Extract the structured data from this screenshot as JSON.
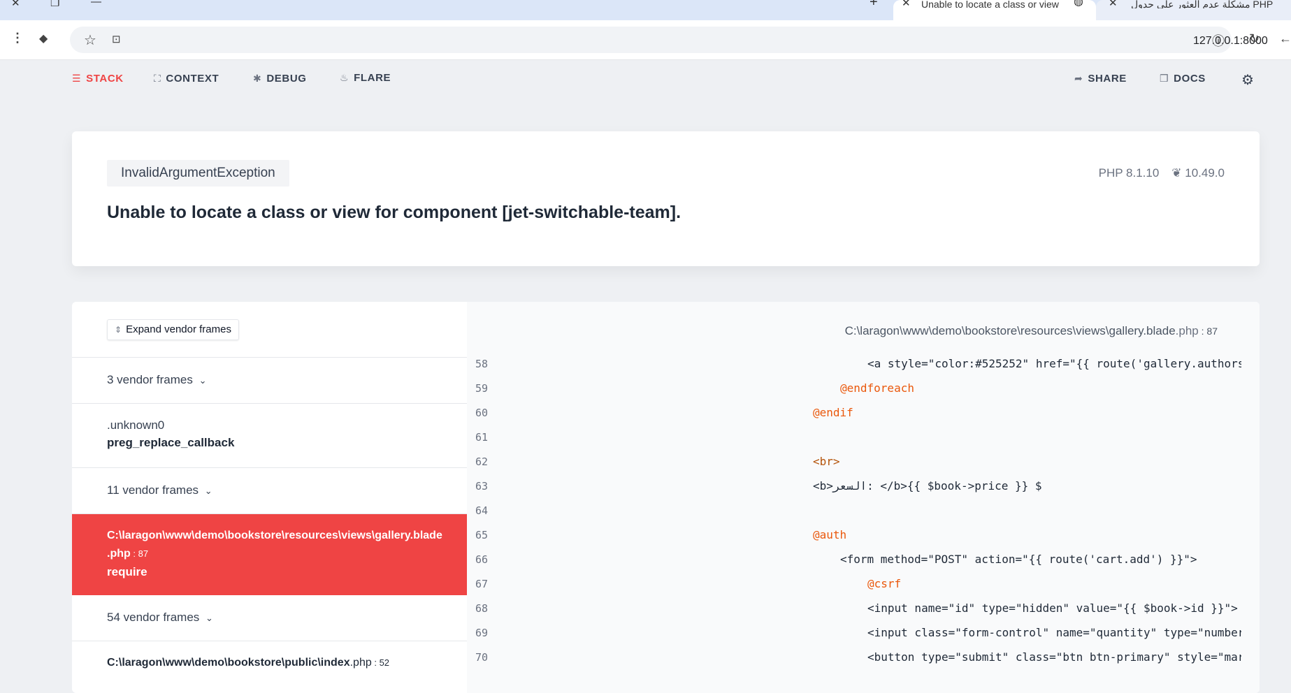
{
  "browser": {
    "tab_add": "+",
    "active_tab": {
      "close": "✕",
      "title": "Unable to locate a class or view"
    },
    "inactive_tab": {
      "close": "✕",
      "title": "مشكلة عدم العثور على جدول PHP"
    },
    "url": "127.0.0.1:8000"
  },
  "toolbar": {
    "stack": "STACK",
    "context": "CONTEXT",
    "debug": "DEBUG",
    "flare": "FLARE",
    "share": "SHARE",
    "docs": "DOCS"
  },
  "exception": {
    "class": "InvalidArgumentException",
    "message": "Unable to locate a class or view for component [jet-switchable-team].",
    "php_version": "PHP 8.1.10",
    "laravel_version": "10.49.0"
  },
  "frames": {
    "expand_label": "Expand vendor frames",
    "items": [
      {
        "type": "vendor",
        "label": "3 vendor frames"
      },
      {
        "type": "frame",
        "sub": ".unknown0",
        "main": "preg_replace_callback"
      },
      {
        "type": "vendor",
        "label": "11 vendor frames"
      },
      {
        "type": "frame",
        "path": "C:\\laragon\\www\\demo\\bookstore\\resources\\views\\gallery.blade",
        "path2": ".php",
        "line": "87",
        "main": "require"
      },
      {
        "type": "vendor",
        "label": "54 vendor frames"
      },
      {
        "type": "frame",
        "path": "C:\\laragon\\www\\demo\\bookstore\\public\\index",
        "ext": ".php",
        "line": "52"
      }
    ]
  },
  "code": {
    "file_path": "C:\\laragon\\www\\demo\\bookstore\\resources\\views\\gallery.blade",
    "file_ext": ".php",
    "file_line": "87",
    "lines": [
      {
        "n": "58",
        "text": "<a style=\"color:#525252\" href=\"{{ route('gallery.authors"
      },
      {
        "n": "59",
        "text": "@endforeach"
      },
      {
        "n": "60",
        "text": "@endif"
      },
      {
        "n": "61",
        "text": ""
      },
      {
        "n": "62",
        "text": "<br>"
      },
      {
        "n": "63",
        "text": "<b>السعر: </b>{{ $book->price }} $"
      },
      {
        "n": "64",
        "text": ""
      },
      {
        "n": "65",
        "text": "@auth"
      },
      {
        "n": "66",
        "text": "<form method=\"POST\" action=\"{{ route('cart.add') }}\">"
      },
      {
        "n": "67",
        "text": "@csrf"
      },
      {
        "n": "68",
        "text": "<input name=\"id\" type=\"hidden\" value=\"{{ $book->id }}\">"
      },
      {
        "n": "69",
        "text": "<input class=\"form-control\" name=\"quantity\" type=\"number"
      },
      {
        "n": "70",
        "text": "<button type=\"submit\" class=\"btn btn-primary\" style=\"mar"
      }
    ]
  }
}
